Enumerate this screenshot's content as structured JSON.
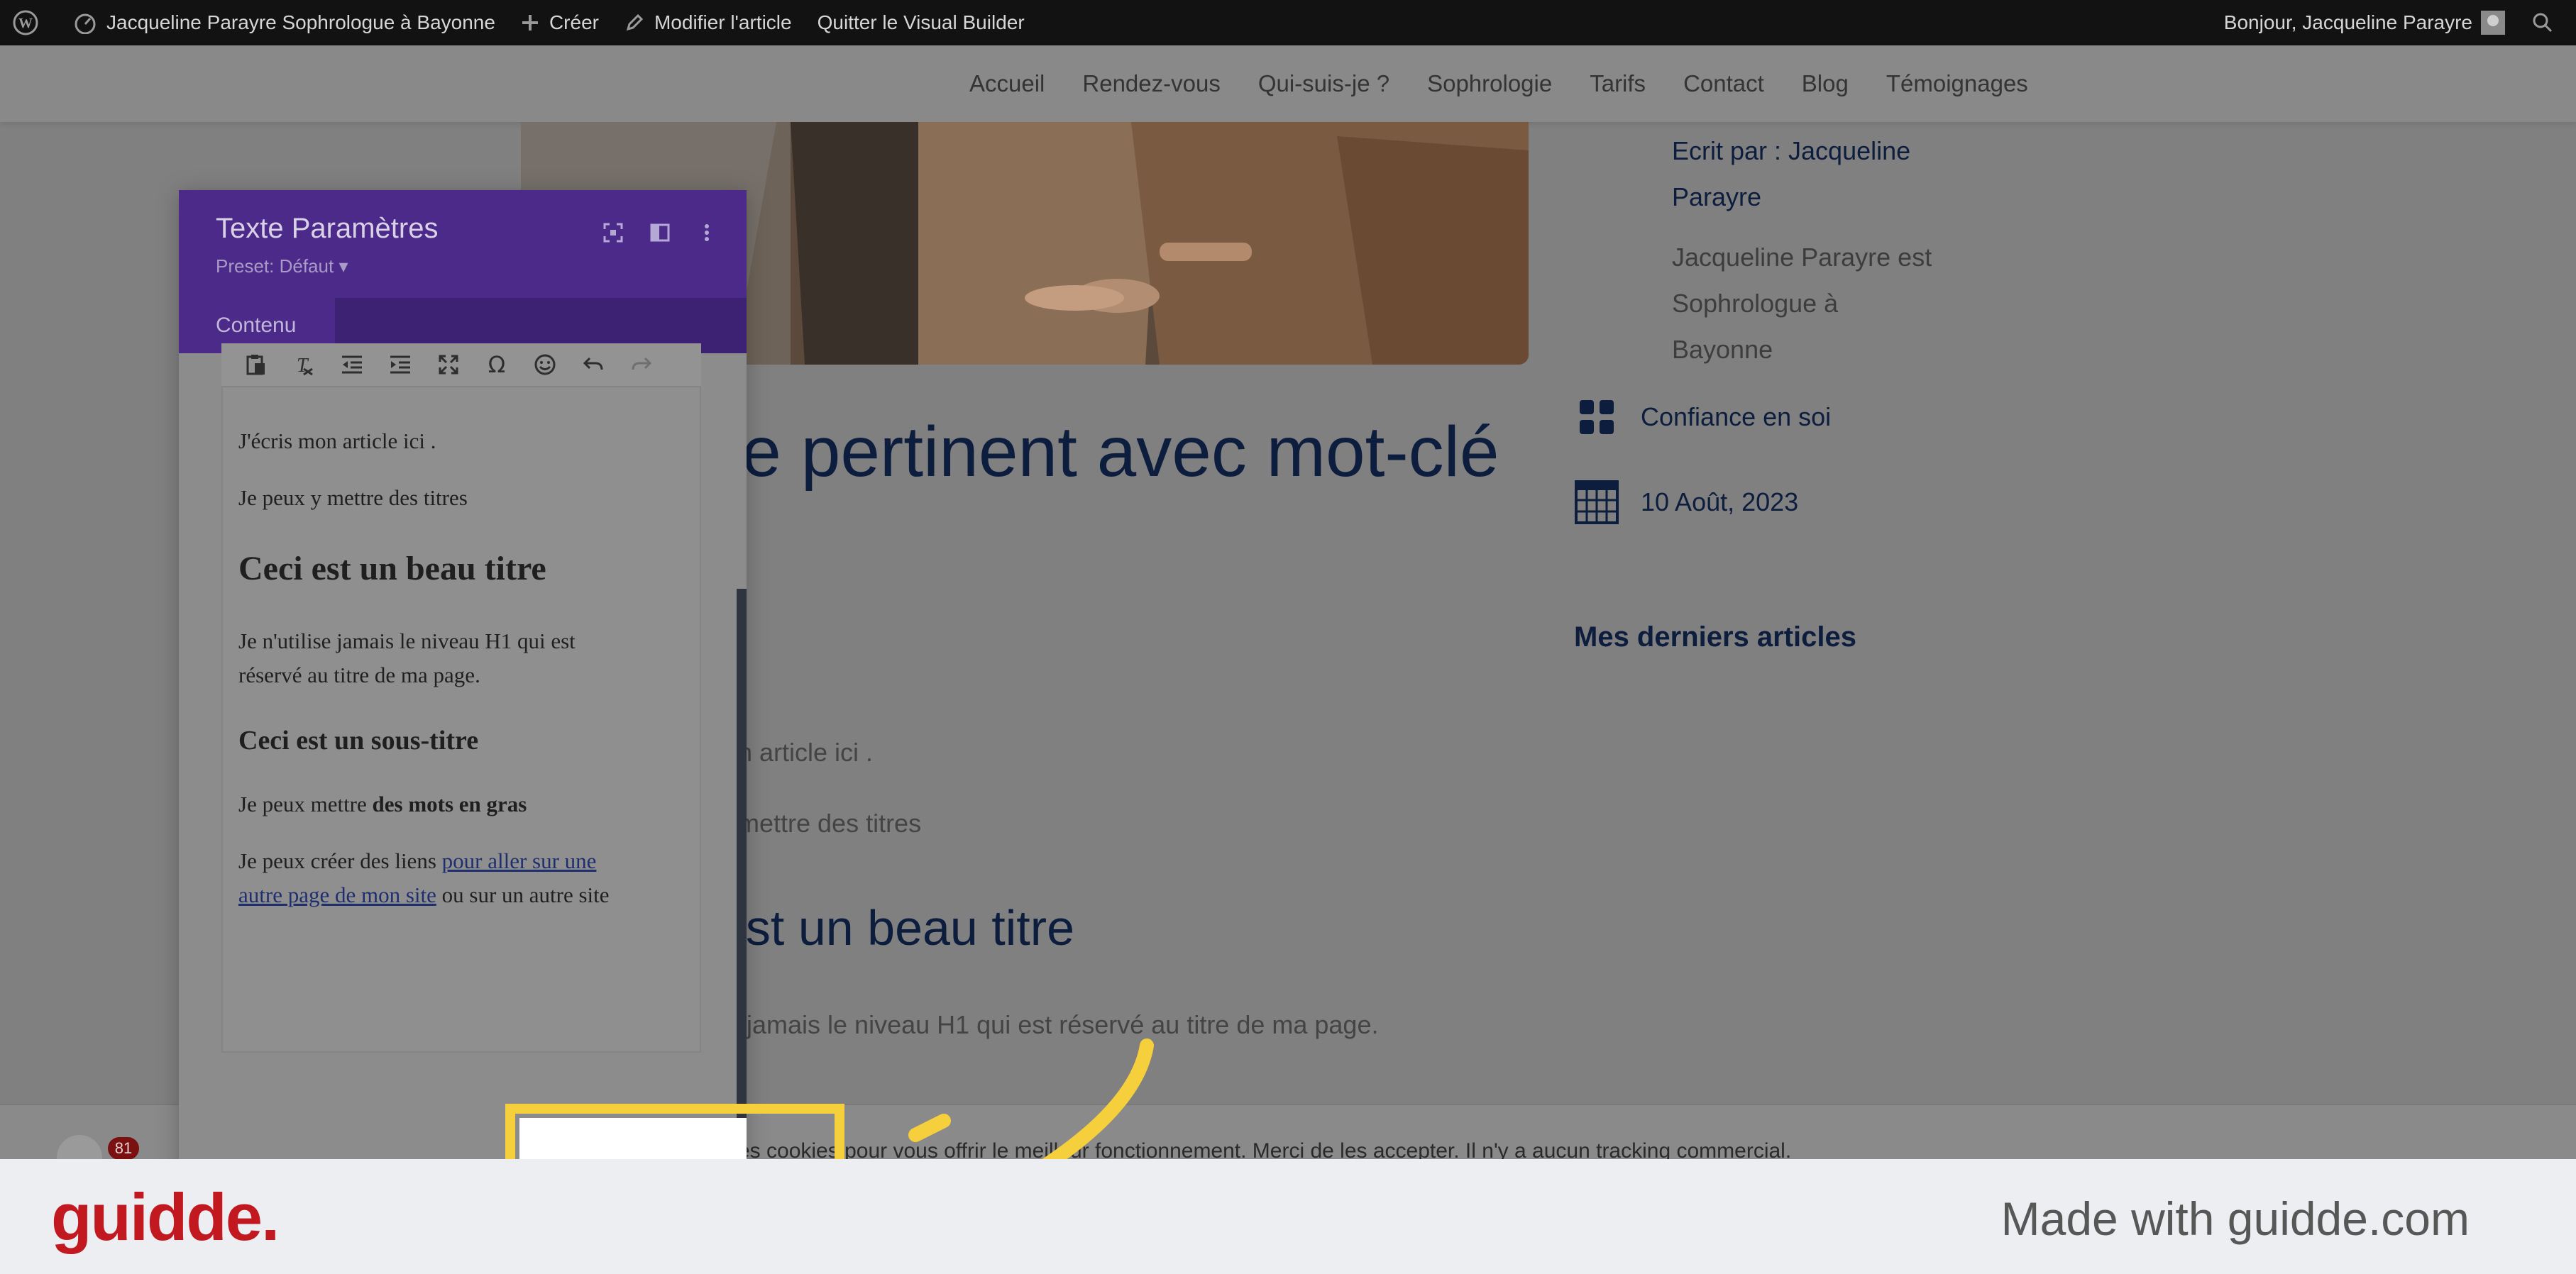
{
  "admin_bar": {
    "site_name": "Jacqueline Parayre Sophrologue à Bayonne",
    "create_label": "Créer",
    "edit_label": "Modifier l'article",
    "exit_builder_label": "Quitter le Visual Builder",
    "greeting": "Bonjour, Jacqueline Parayre"
  },
  "nav": {
    "items": [
      {
        "label": "Accueil"
      },
      {
        "label": "Rendez-vous"
      },
      {
        "label": "Qui-suis-je ?"
      },
      {
        "label": "Sophrologie"
      },
      {
        "label": "Tarifs"
      },
      {
        "label": "Contact"
      },
      {
        "label": "Blog"
      },
      {
        "label": "Témoignages"
      }
    ]
  },
  "article": {
    "title_visible": "re pertinent avec mot-clé",
    "p1_visible": "n article ici .",
    "p2_visible": "mettre des titres",
    "h2_visible": "est un beau titre",
    "p3_visible": "jamais le niveau H1 qui est réservé au titre de ma page."
  },
  "sidebar": {
    "author_line1": "Ecrit par : Jacqueline",
    "author_line2": "Parayre",
    "bio_line1": "Jacqueline Parayre est",
    "bio_line2": "Sophrologue à",
    "bio_line3": "Bayonne",
    "category": "Confiance en soi",
    "date": "10 Août, 2023",
    "recent_title": "Mes derniers articles"
  },
  "cookie_bar": {
    "badge_count": "81",
    "text_visible": "es cookies pour vous offrir le meilleur fonctionnement. Merci de les accepter. Il n'y a aucun tracking commercial."
  },
  "panel": {
    "title": "Texte Paramètres",
    "preset": "Preset: Défaut",
    "tab_content": "Contenu",
    "editor": {
      "p1": "J'écris mon article ici .",
      "p2": "Je peux y mettre des titres",
      "h2": "Ceci est un beau titre",
      "p3_line1": "Je n'utilise jamais le niveau H1 qui est",
      "p3_line2": "réservé au titre de ma page.",
      "h3": "Ceci est un sous-titre",
      "p4_prefix": "Je peux mettre ",
      "p4_bold": "des mots en gras",
      "p5_prefix": "Je peux créer des liens ",
      "p5_link_line1": "pour aller sur une",
      "p5_link_line2": "autre page de mon site",
      "p5_suffix": " ou sur un autre site"
    }
  },
  "footer": {
    "logo": "guidde.",
    "made_with": "Made with guidde.com"
  },
  "colors": {
    "admin_bar_bg": "#121212",
    "panel_header": "#4b2a8a",
    "highlight": "#f6cf3c",
    "guidde_red": "#c2181f",
    "title_navy": "#0c1d3d"
  }
}
